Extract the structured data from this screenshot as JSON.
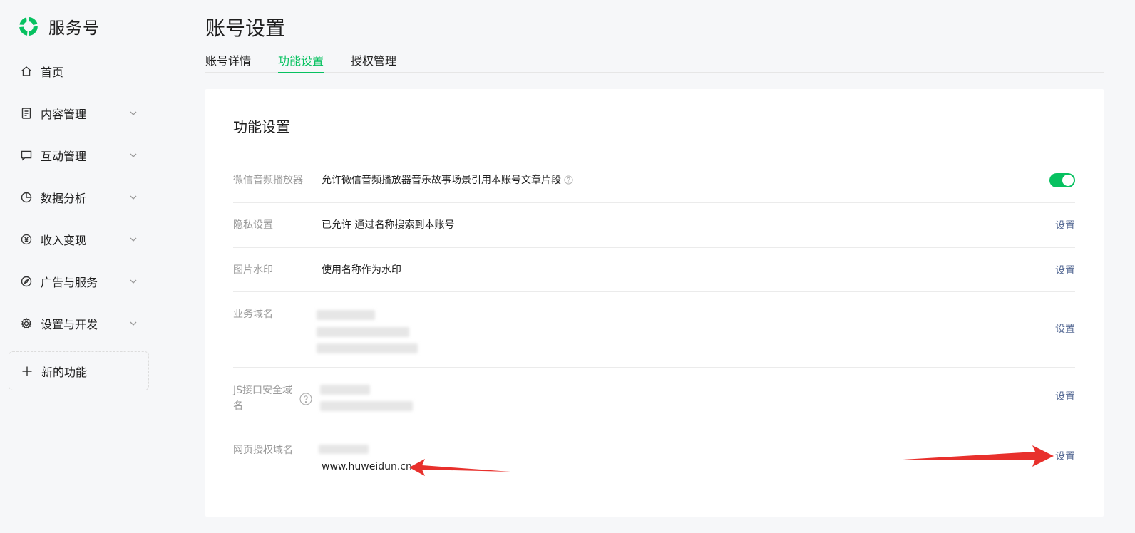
{
  "brand": {
    "name": "服务号"
  },
  "nav": {
    "items": [
      {
        "label": "首页",
        "icon": "home-icon",
        "expandable": false
      },
      {
        "label": "内容管理",
        "icon": "document-icon",
        "expandable": true
      },
      {
        "label": "互动管理",
        "icon": "chat-icon",
        "expandable": true
      },
      {
        "label": "数据分析",
        "icon": "pie-chart-icon",
        "expandable": true
      },
      {
        "label": "收入变现",
        "icon": "yen-icon",
        "expandable": true
      },
      {
        "label": "广告与服务",
        "icon": "compass-icon",
        "expandable": true
      },
      {
        "label": "设置与开发",
        "icon": "gear-icon",
        "expandable": true
      }
    ],
    "new_feature": {
      "label": "新的功能",
      "icon": "plus-icon"
    }
  },
  "page": {
    "title": "账号设置",
    "tabs": [
      {
        "label": "账号详情",
        "active": false
      },
      {
        "label": "功能设置",
        "active": true
      },
      {
        "label": "授权管理",
        "active": false
      }
    ]
  },
  "card": {
    "title": "功能设置",
    "rows": {
      "audio_player": {
        "label": "微信音频播放器",
        "value": "允许微信音频播放器音乐故事场景引用本账号文章片段",
        "toggle_on": true
      },
      "privacy": {
        "label": "隐私设置",
        "value": "已允许 通过名称搜索到本账号",
        "action": "设置"
      },
      "watermark": {
        "label": "图片水印",
        "value": "使用名称作为水印",
        "action": "设置"
      },
      "business_domain": {
        "label": "业务域名",
        "action": "设置"
      },
      "js_domain": {
        "label_line1": "JS接口安全域",
        "label_line2": "名",
        "action": "设置"
      },
      "oauth_domain": {
        "label": "网页授权域名",
        "value": "www.huweidun.cn",
        "action": "设置"
      }
    }
  },
  "colors": {
    "accent": "#07c160",
    "link": "#576b95",
    "arrow": "#e8302c"
  }
}
